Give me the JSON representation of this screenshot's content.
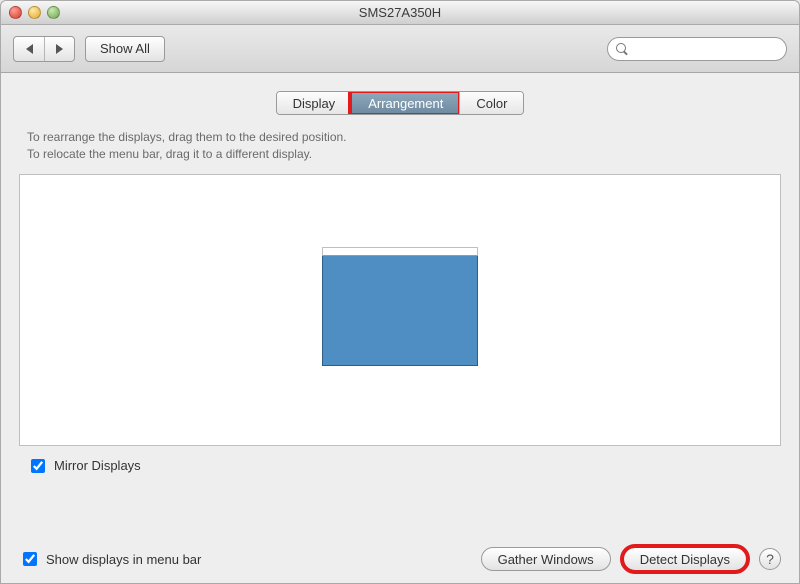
{
  "window": {
    "title": "SMS27A350H"
  },
  "toolbar": {
    "show_all": "Show All"
  },
  "search": {
    "placeholder": ""
  },
  "tabs": {
    "display": "Display",
    "arrangement": "Arrangement",
    "color": "Color"
  },
  "hints": {
    "line1": "To rearrange the displays, drag them to the desired position.",
    "line2": "To relocate the menu bar, drag it to a different display."
  },
  "checks": {
    "mirror": "Mirror Displays",
    "menubar": "Show displays in menu bar"
  },
  "buttons": {
    "gather": "Gather Windows",
    "detect": "Detect Displays"
  },
  "highlights": {
    "arrangement_tab": true,
    "detect_button": true
  }
}
